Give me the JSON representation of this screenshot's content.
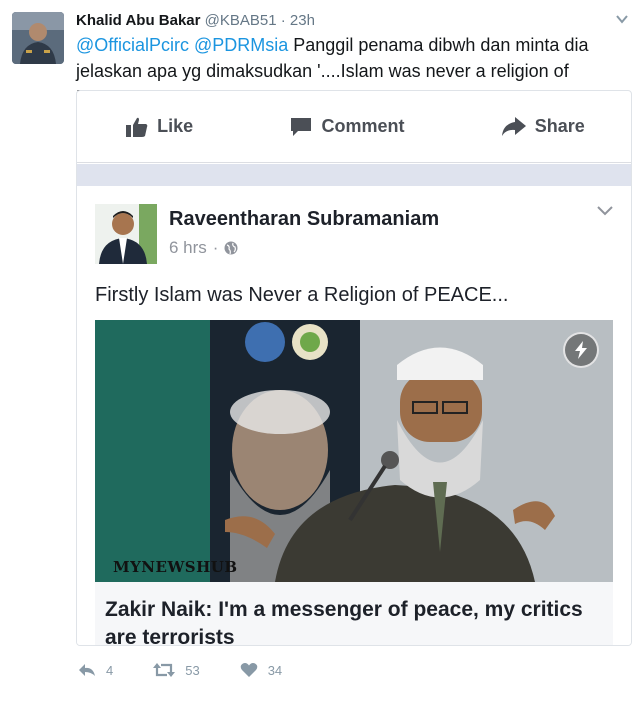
{
  "tweet": {
    "author_name": "Khalid Abu Bakar",
    "handle": "@KBAB51",
    "dot": "·",
    "time": "23h",
    "mention1": "@OfficialPcirc",
    "mention2": "@PDRMsia",
    "text": " Panggil penama dibwh dan minta dia jelaskan apa yg dimaksudkan '....Islam was never a religion of PEACE'"
  },
  "facebook": {
    "actions": {
      "like": "Like",
      "comment": "Comment",
      "share": "Share"
    },
    "post": {
      "author": "Raveentharan Subramaniam",
      "time": "6 hrs",
      "sep": "·",
      "text": "Firstly  Islam was Never a Religion of PEACE...",
      "image_watermark": "MYNEWSHUB",
      "link_title": "Zakir Naik: I'm a messenger of peace, my critics are terrorists"
    }
  },
  "actions": {
    "replies": "4",
    "retweets": "53",
    "likes": "34"
  },
  "colors": {
    "link": "#1b95e0",
    "muted": "#8899a6",
    "fb_gray": "#4b4f56"
  }
}
